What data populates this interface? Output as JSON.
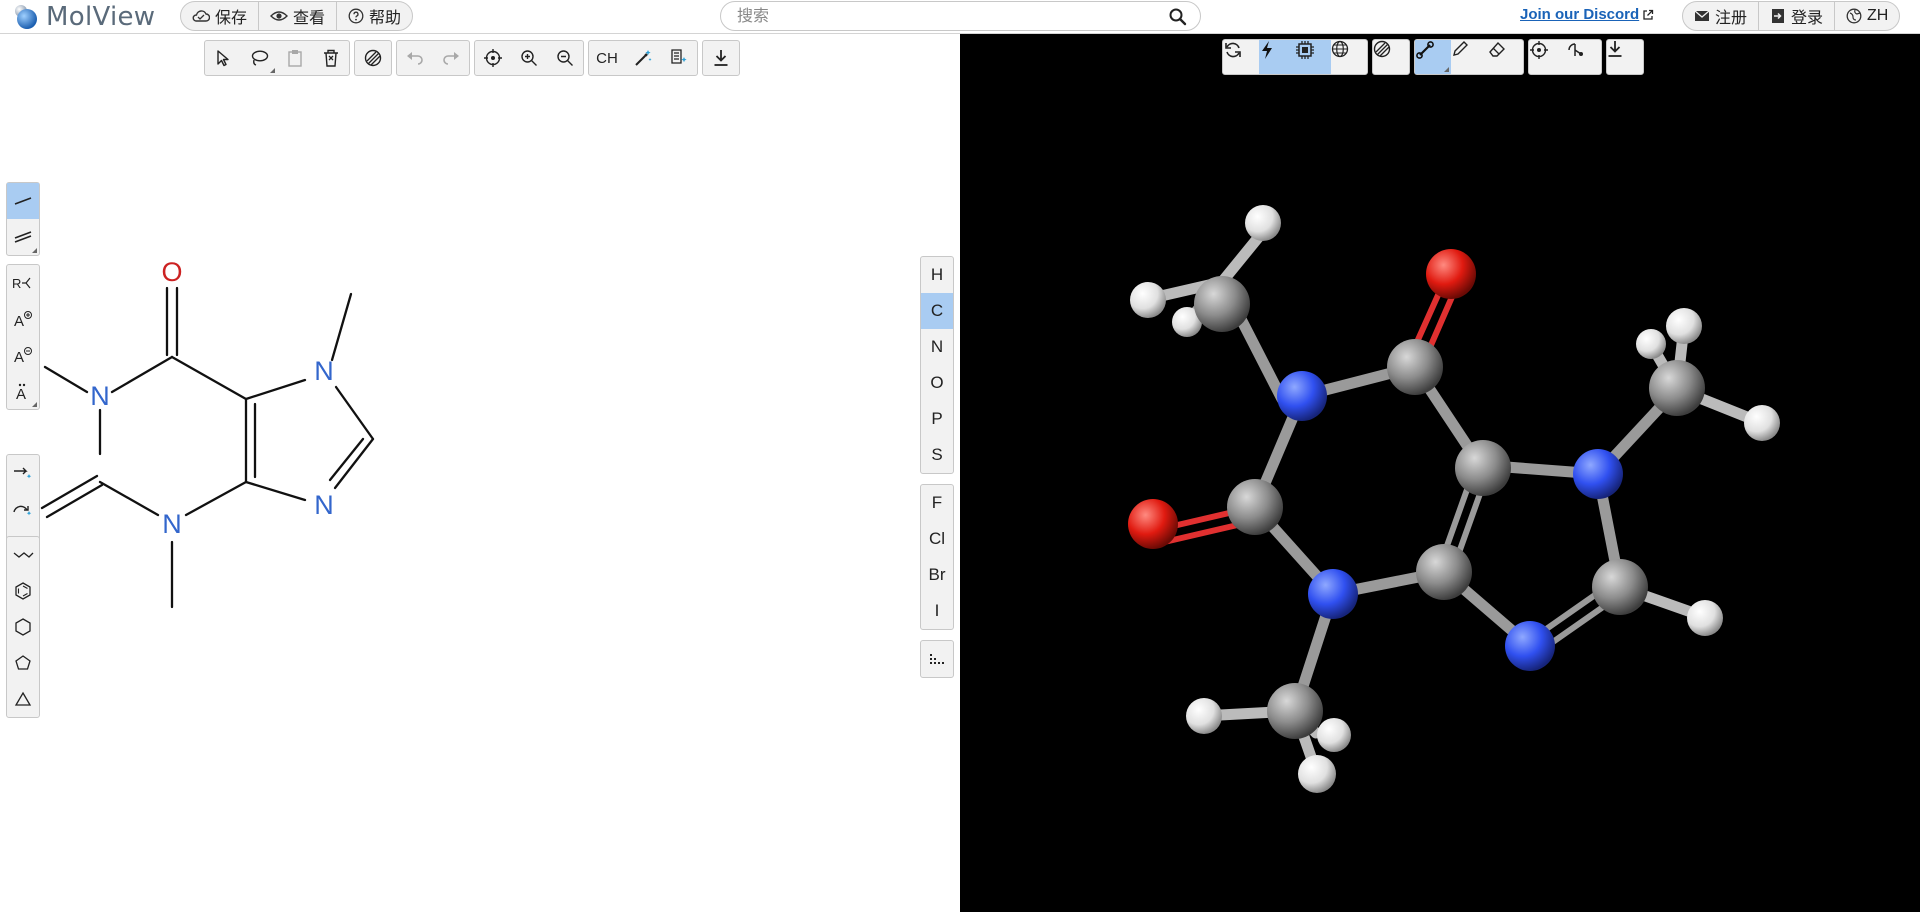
{
  "app": {
    "name": "MolView"
  },
  "topbar": {
    "menu": [
      {
        "label": "保存",
        "icon": "cloud-icon"
      },
      {
        "label": "查看",
        "icon": "eye-icon"
      },
      {
        "label": "帮助",
        "icon": "help-icon"
      }
    ],
    "search_placeholder": "搜索",
    "discord_label": "Join our Discord",
    "account": [
      {
        "label": "注册",
        "icon": "mail-icon"
      },
      {
        "label": "登录",
        "icon": "login-icon"
      },
      {
        "label": "ZH",
        "icon": "globe-icon"
      }
    ]
  },
  "editor": {
    "elements_a": [
      "H",
      "C",
      "N",
      "O",
      "P",
      "S"
    ],
    "elements_b": [
      "F",
      "Cl",
      "Br",
      "I"
    ],
    "selected_element": "C",
    "toolbar_text_button": "CH",
    "molecule": {
      "atom_labels": [
        "O",
        "N",
        "N",
        "N",
        "N"
      ]
    }
  },
  "colors": {
    "accent": "#a9ccf2",
    "nitrogen_2d": "#3366cc",
    "oxygen_2d": "#cc2222",
    "viewer_bg": "#000000",
    "link": "#1a63b8"
  }
}
